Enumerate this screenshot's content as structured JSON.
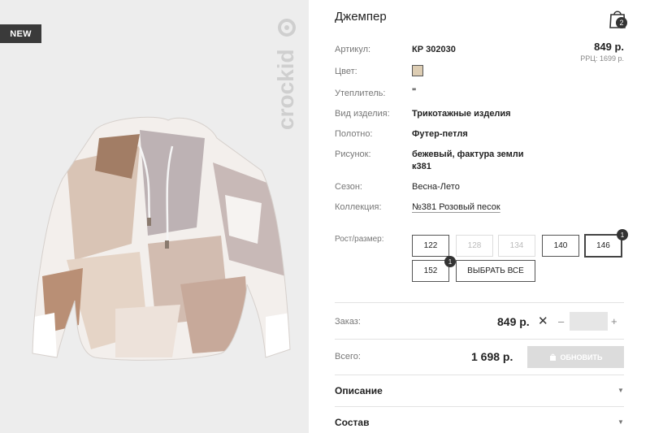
{
  "badge": {
    "new": "NEW"
  },
  "brand": {
    "logo_text": "crockid"
  },
  "product": {
    "title": "Джемпер",
    "price": "849 р.",
    "rrp": "PPЦ: 1699 р.",
    "swatch_color": "#ddcdb3"
  },
  "cart": {
    "count": "2"
  },
  "details": [
    {
      "label": "Артикул:",
      "value": "КР 302030",
      "style": "bold"
    },
    {
      "label": "Цвет:",
      "value": ""
    },
    {
      "label": "Утеплитель:",
      "value": "\"",
      "style": "bold"
    },
    {
      "label": "Вид изделия:",
      "value": "Трикотажные изделия",
      "style": "bold"
    },
    {
      "label": "Полотно:",
      "value": "Футер-петля",
      "style": "bold"
    },
    {
      "label": "Рисунок:",
      "value": "бежевый, фактура земли к381",
      "style": "bold"
    },
    {
      "label": "Сезон:",
      "value": "Весна-Лето",
      "style": "normal"
    },
    {
      "label": "Коллекция:",
      "value": "№381 Розовый песок",
      "style": "link"
    }
  ],
  "sizes": {
    "label": "Рост/размер:",
    "items": [
      {
        "label": "122",
        "state": "available"
      },
      {
        "label": "128",
        "state": "disabled"
      },
      {
        "label": "134",
        "state": "disabled"
      },
      {
        "label": "140",
        "state": "available"
      },
      {
        "label": "146",
        "state": "selected",
        "badge": "1"
      },
      {
        "label": "152",
        "state": "available",
        "badge": "1"
      }
    ],
    "select_all": "ВЫБРАТЬ ВСЕ"
  },
  "order": {
    "label": "Заказ:",
    "price": "849 р.",
    "times": "✕",
    "minus": "–",
    "plus": "+",
    "quantity": ""
  },
  "total": {
    "label": "Всего:",
    "price": "1 698 р.",
    "update_button": "ОБНОВИТЬ"
  },
  "sections": [
    {
      "title": "Описание"
    },
    {
      "title": "Состав"
    }
  ],
  "colors": {
    "image_bg": "#ededed",
    "badge_bg": "#3a3a3a",
    "button_disabled": "#dcdcdc"
  }
}
